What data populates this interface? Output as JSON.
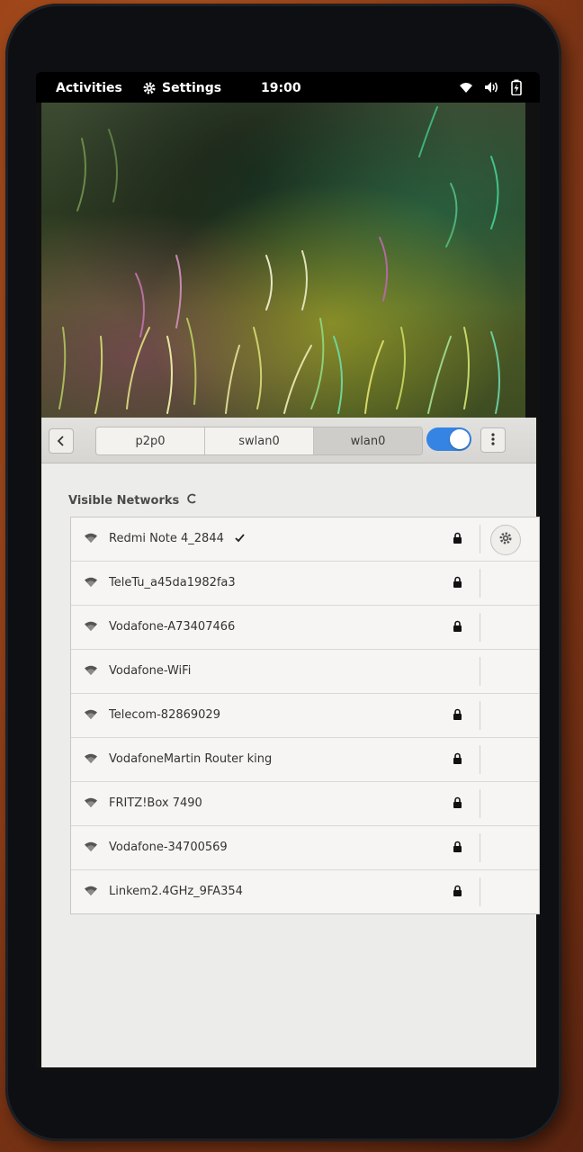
{
  "topbar": {
    "activities_label": "Activities",
    "settings_label": "Settings",
    "clock": "19:00",
    "status_icons": [
      "wifi-icon",
      "volume-icon",
      "battery-icon"
    ]
  },
  "headerbar": {
    "tabs": [
      {
        "label": "p2p0",
        "active": false
      },
      {
        "label": "swlan0",
        "active": false
      },
      {
        "label": "wlan0",
        "active": true
      }
    ],
    "toggle_on": true,
    "accent": "#3584e4"
  },
  "section": {
    "title": "Visible Networks"
  },
  "networks": [
    {
      "name": "Redmi Note 4_2844",
      "connected": true,
      "secured": true,
      "has_settings": true
    },
    {
      "name": "TeleTu_a45da1982fa3",
      "connected": false,
      "secured": true,
      "has_settings": false
    },
    {
      "name": "Vodafone-A73407466",
      "connected": false,
      "secured": true,
      "has_settings": false
    },
    {
      "name": "Vodafone-WiFi",
      "connected": false,
      "secured": false,
      "has_settings": false
    },
    {
      "name": "Telecom-82869029",
      "connected": false,
      "secured": true,
      "has_settings": false
    },
    {
      "name": "VodafoneMartin Router king",
      "connected": false,
      "secured": true,
      "has_settings": false
    },
    {
      "name": "FRITZ!Box 7490",
      "connected": false,
      "secured": true,
      "has_settings": false
    },
    {
      "name": "Vodafone-34700569",
      "connected": false,
      "secured": true,
      "has_settings": false
    },
    {
      "name": "Linkem2.4GHz_9FA354",
      "connected": false,
      "secured": true,
      "has_settings": false
    }
  ]
}
